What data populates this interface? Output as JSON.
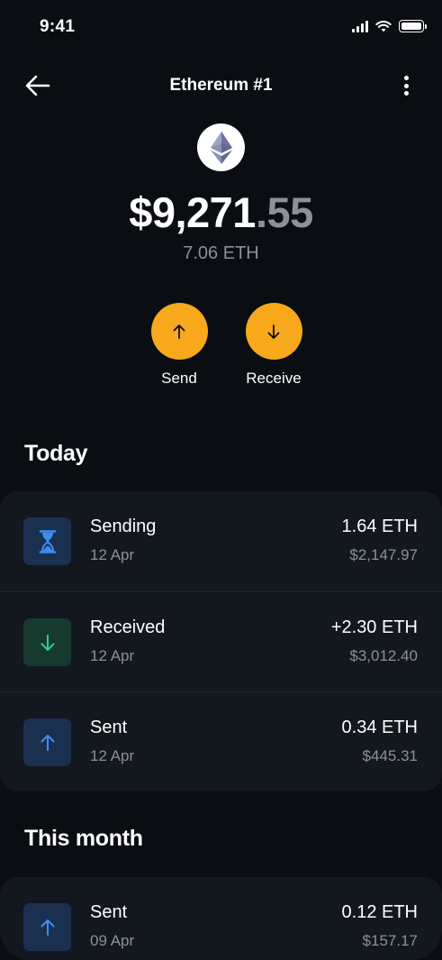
{
  "status_bar": {
    "time": "9:41"
  },
  "header": {
    "title": "Ethereum #1"
  },
  "balance": {
    "main": "$9,271",
    "cents": ".55",
    "crypto": "7.06 ETH"
  },
  "actions": {
    "send_label": "Send",
    "receive_label": "Receive"
  },
  "colors": {
    "accent": "#f8a81b",
    "background": "#0a0d12",
    "card": "#13171e",
    "muted": "#8b9099",
    "pending_blue": "#3d8fef",
    "received_green": "#2ecf8e"
  },
  "sections": [
    {
      "title": "Today",
      "transactions": [
        {
          "title": "Sending",
          "date": "12 Apr",
          "amount": "1.64 ETH",
          "fiat": "$2,147.97",
          "icon": "hourglass-icon"
        },
        {
          "title": "Received",
          "date": "12 Apr",
          "amount": "+2.30 ETH",
          "fiat": "$3,012.40",
          "icon": "arrow-down-icon"
        },
        {
          "title": "Sent",
          "date": "12 Apr",
          "amount": "0.34 ETH",
          "fiat": "$445.31",
          "icon": "arrow-up-icon"
        }
      ]
    },
    {
      "title": "This month",
      "transactions": [
        {
          "title": "Sent",
          "date": "09 Apr",
          "amount": "0.12 ETH",
          "fiat": "$157.17",
          "icon": "arrow-up-icon"
        }
      ]
    }
  ]
}
